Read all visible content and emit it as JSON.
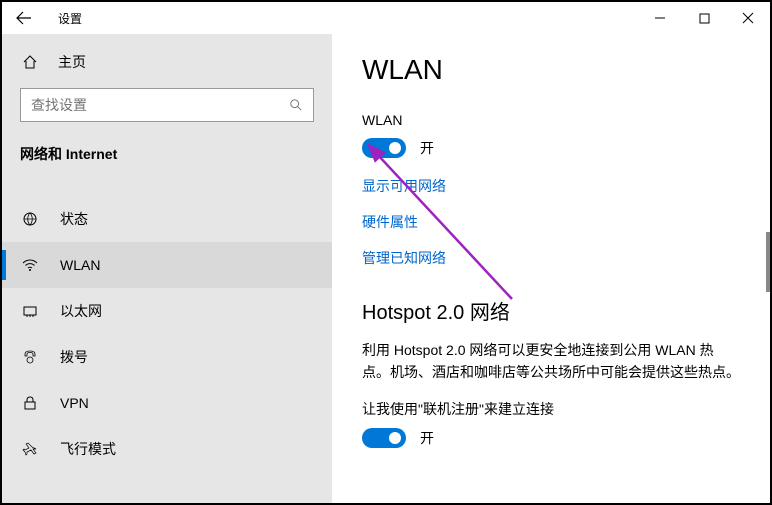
{
  "titlebar": {
    "title": "设置"
  },
  "sidebar": {
    "home_label": "主页",
    "search_placeholder": "查找设置",
    "section_label": "网络和 Internet",
    "items": [
      {
        "label": "状态"
      },
      {
        "label": "WLAN"
      },
      {
        "label": "以太网"
      },
      {
        "label": "拨号"
      },
      {
        "label": "VPN"
      },
      {
        "label": "飞行模式"
      }
    ]
  },
  "content": {
    "heading": "WLAN",
    "wlan_subhead": "WLAN",
    "wlan_toggle_state": "开",
    "links": {
      "show_networks": "显示可用网络",
      "hw_props": "硬件属性",
      "manage_known": "管理已知网络"
    },
    "hotspot_heading": "Hotspot 2.0 网络",
    "hotspot_body": "利用 Hotspot 2.0 网络可以更安全地连接到公用 WLAN 热点。机场、酒店和咖啡店等公共场所中可能会提供这些热点。",
    "hotspot_toggle_label": "让我使用\"联机注册\"来建立连接",
    "hotspot_toggle_state": "开"
  }
}
